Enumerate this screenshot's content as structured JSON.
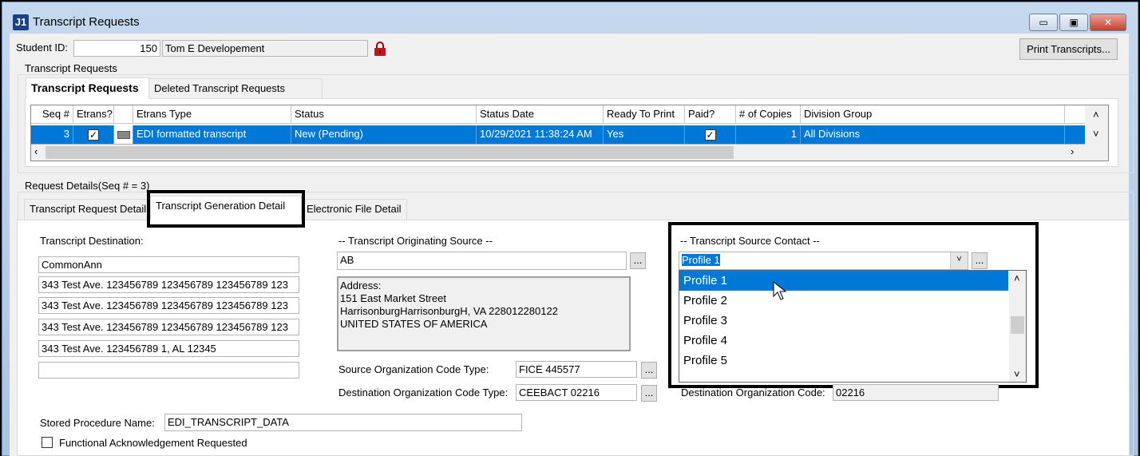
{
  "window": {
    "title": "Transcript Requests",
    "icon": "J1",
    "minimize": "▭",
    "maximize": "▣",
    "close": "✕"
  },
  "student": {
    "label": "Student ID:",
    "id": "150",
    "name": "Tom E Developement",
    "lock_icon": "lock-icon"
  },
  "print_button": "Print Transcripts...",
  "requests_group": {
    "label": "Transcript Requests",
    "tabs": [
      "Transcript Requests",
      "Deleted Transcript Requests"
    ]
  },
  "grid": {
    "headers": [
      "Seq #",
      "Etrans?",
      "",
      "Etrans Type",
      "Status",
      "Status Date",
      "Ready To Print",
      "Paid?",
      "# of Copies",
      "Division Group"
    ],
    "row": {
      "seq": "3",
      "etrans": true,
      "etrans_type": "EDI formatted transcript",
      "status": "New (Pending)",
      "status_date": "10/29/2021 11:38:24 AM",
      "ready": "Yes",
      "paid": true,
      "copies": "1",
      "division": "All Divisions"
    }
  },
  "details_group": {
    "label": "Request Details(Seq # = 3)",
    "tabs": [
      "Transcript Request Detail",
      "Transcript Generation Detail",
      "Electronic File Detail"
    ]
  },
  "destination": {
    "label": "Transcript Destination:",
    "lines": [
      "CommonAnn",
      "343 Test Ave. 123456789 123456789 123456789 123",
      "343 Test Ave. 123456789 123456789 123456789 123",
      "343 Test Ave. 123456789 123456789 123456789 123",
      "343 Test Ave. 123456789 1, AL 12345",
      ""
    ]
  },
  "originating": {
    "label": "-- Transcript Originating Source --",
    "value": "AB",
    "address": [
      "Address:",
      "151 East Market Street",
      "HarrisonburgHarrisonburgH, VA 228012280122",
      "UNITED STATES OF AMERICA"
    ],
    "src_code_type_label": "Source Organization Code Type:",
    "src_code_type": "FICE  445577",
    "dest_code_type_label": "Destination Organization Code Type:",
    "dest_code_type": "CEEBACT  02216"
  },
  "contact": {
    "label": "-- Transcript Source Contact --",
    "value": "Profile 1",
    "options": [
      "Profile 1",
      "Profile 2",
      "Profile 3",
      "Profile 4",
      "Profile 5"
    ]
  },
  "dest_org_code": {
    "label": "Destination Organization Code:",
    "value": "02216"
  },
  "stored_proc": {
    "label": "Stored Procedure Name:",
    "value": "EDI_TRANSCRIPT_DATA"
  },
  "ack": {
    "label": "Functional Acknowledgement Requested",
    "checked": false
  },
  "ellipsis": "..."
}
